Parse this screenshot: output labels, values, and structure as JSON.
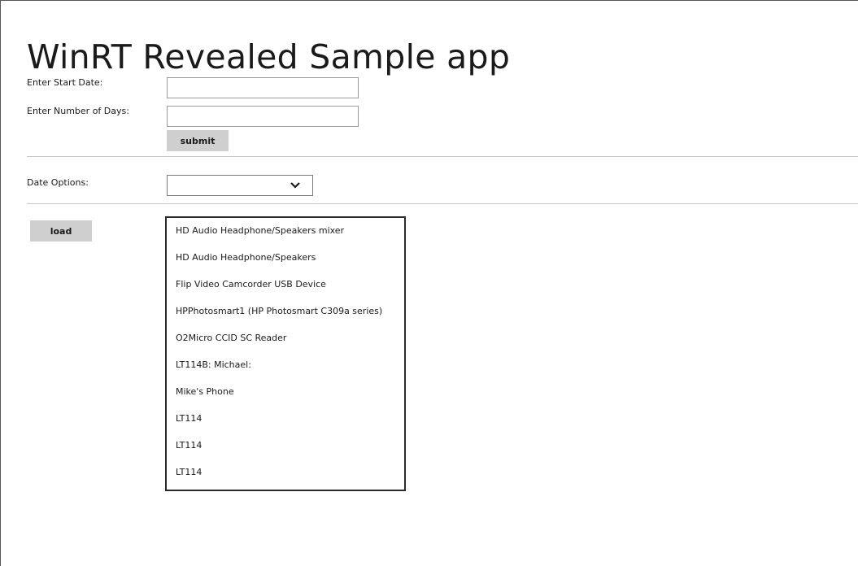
{
  "app": {
    "title": "WinRT Revealed Sample app"
  },
  "form": {
    "start_date_label": "Enter Start Date:",
    "start_date_value": "",
    "days_label": "Enter Number of Days:",
    "days_value": "",
    "submit_label": "submit"
  },
  "options": {
    "date_options_label": "Date Options:",
    "date_options_selected": "",
    "chevron_icon": "chevron-down-icon"
  },
  "devices": {
    "load_label": "load",
    "items": [
      "HD Audio Headphone/Speakers mixer",
      "HD Audio Headphone/Speakers",
      "Flip Video Camcorder USB Device",
      "HPPhotosmart1 (HP Photosmart C309a series)",
      "O2Micro CCID SC Reader",
      "LT114B: Michael:",
      "Mike's Phone",
      "LT114",
      "LT114",
      "LT114"
    ]
  },
  "colors": {
    "button_bg": "#cfcfcf",
    "divider": "#c8c8c8",
    "list_border": "#2a2a2a"
  }
}
